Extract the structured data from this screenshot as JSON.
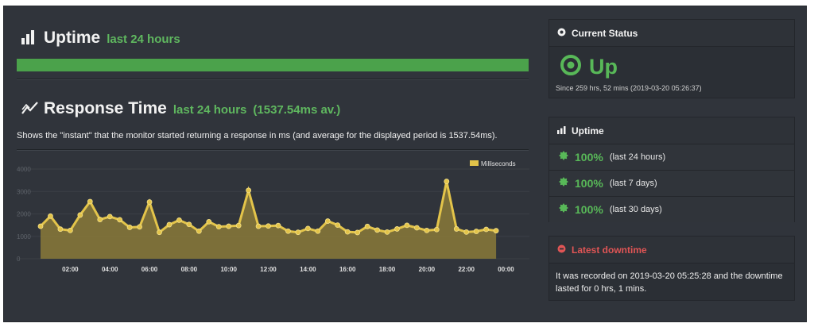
{
  "uptime_section": {
    "title": "Uptime",
    "subtitle": "last 24 hours",
    "bar_fraction": 1.0
  },
  "response_section": {
    "title": "Response Time",
    "subtitle": "last 24 hours",
    "average": "(1537.54ms av.)",
    "description": "Shows the \"instant\" that the monitor started returning a response in ms (and average for the displayed period is 1537.54ms)."
  },
  "current_status": {
    "header": "Current Status",
    "status": "Up",
    "since": "Since 259 hrs, 52 mins (2019-03-20 05:26:37)"
  },
  "uptime_panel": {
    "header": "Uptime",
    "rows": [
      {
        "percent": "100%",
        "label": "(last 24 hours)"
      },
      {
        "percent": "100%",
        "label": "(last 7 days)"
      },
      {
        "percent": "100%",
        "label": "(last 30 days)"
      }
    ]
  },
  "latest_downtime": {
    "header": "Latest downtime",
    "text": "It was recorded on 2019-03-20 05:25:28 and the downtime lasted for 0 hrs, 1 mins."
  },
  "colors": {
    "green": "#58b858",
    "bar_green": "#4ba24b",
    "series": "#e3c44a",
    "fill": "#8a7a3a",
    "red": "#e05555"
  },
  "chart_data": {
    "type": "area",
    "legend": "Milliseconds",
    "legend_position": "top-right",
    "ylim": [
      0,
      4000
    ],
    "y_ticks": [
      0,
      1000,
      2000,
      3000,
      4000
    ],
    "x_ticks": [
      "02:00",
      "04:00",
      "06:00",
      "08:00",
      "10:00",
      "12:00",
      "14:00",
      "16:00",
      "18:00",
      "20:00",
      "22:00",
      "00:00"
    ],
    "x_hours": [
      0.5,
      1.0,
      1.5,
      2.0,
      2.5,
      3.0,
      3.5,
      4.0,
      4.5,
      5.0,
      5.5,
      6.0,
      6.5,
      7.0,
      7.5,
      8.0,
      8.5,
      9.0,
      9.5,
      10.0,
      10.5,
      11.0,
      11.5,
      12.0,
      12.5,
      13.0,
      13.5,
      14.0,
      14.5,
      15.0,
      15.5,
      16.0,
      16.5,
      17.0,
      17.5,
      18.0,
      18.5,
      19.0,
      19.5,
      20.0,
      20.5,
      21.0,
      21.5,
      22.0,
      22.5,
      23.0,
      23.5,
      24.0,
      24.5
    ],
    "values": [
      1450,
      1900,
      1320,
      1260,
      1950,
      2550,
      1750,
      1880,
      1740,
      1400,
      1420,
      2530,
      1180,
      1520,
      1720,
      1530,
      1230,
      1650,
      1430,
      1450,
      1480,
      3050,
      1450,
      1460,
      1480,
      1230,
      1180,
      1350,
      1230,
      1680,
      1500,
      1200,
      1170,
      1440,
      1280,
      1190,
      1330,
      1490,
      1380,
      1260,
      1300,
      3450,
      1330,
      1190,
      1220,
      1310,
      1250
    ],
    "grid": true
  }
}
